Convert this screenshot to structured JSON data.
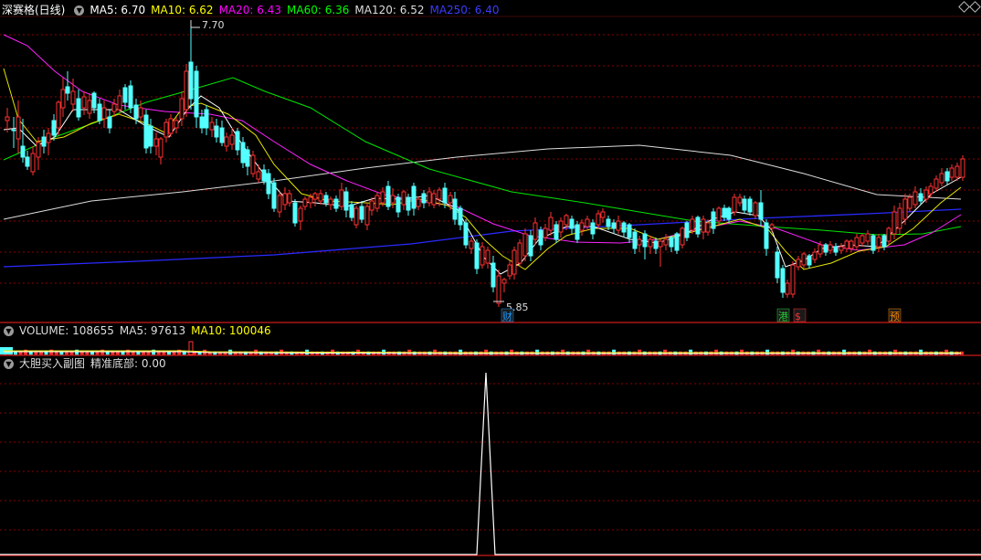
{
  "main_header": {
    "stock_title": "深赛格(日线)",
    "ma_items": [
      {
        "label": "MA5: 6.70",
        "color": "#ffffff"
      },
      {
        "label": "MA10: 6.62",
        "color": "#ffff00"
      },
      {
        "label": "MA20: 6.43",
        "color": "#ff00ff"
      },
      {
        "label": "MA60: 6.36",
        "color": "#00ff00"
      },
      {
        "label": "MA120: 6.52",
        "color": "#dddddd"
      },
      {
        "label": "MA250: 6.40",
        "color": "#3b3bff"
      }
    ]
  },
  "price_annotations": {
    "high": "7.70",
    "low": "5.85"
  },
  "event_markers": [
    {
      "text": "财",
      "color": "#1a9bff"
    },
    {
      "text": "港",
      "color": "#22cc33"
    },
    {
      "text": "$",
      "color": "#ff3333"
    },
    {
      "text": "预",
      "color": "#ff8800"
    }
  ],
  "volume_header": [
    {
      "label": "VOLUME: 108655",
      "color": "#dddddd"
    },
    {
      "label": "MA5: 97613",
      "color": "#dddddd"
    },
    {
      "label": "MA10: 100046",
      "color": "#ffff00"
    }
  ],
  "indicator_header": {
    "name": "大胆买入副图",
    "value_label": "精准底部: 0.00"
  },
  "colors": {
    "up": "#ff3232",
    "down": "#54ffff",
    "grid": "#8b0000",
    "border": "#ff2020"
  }
}
